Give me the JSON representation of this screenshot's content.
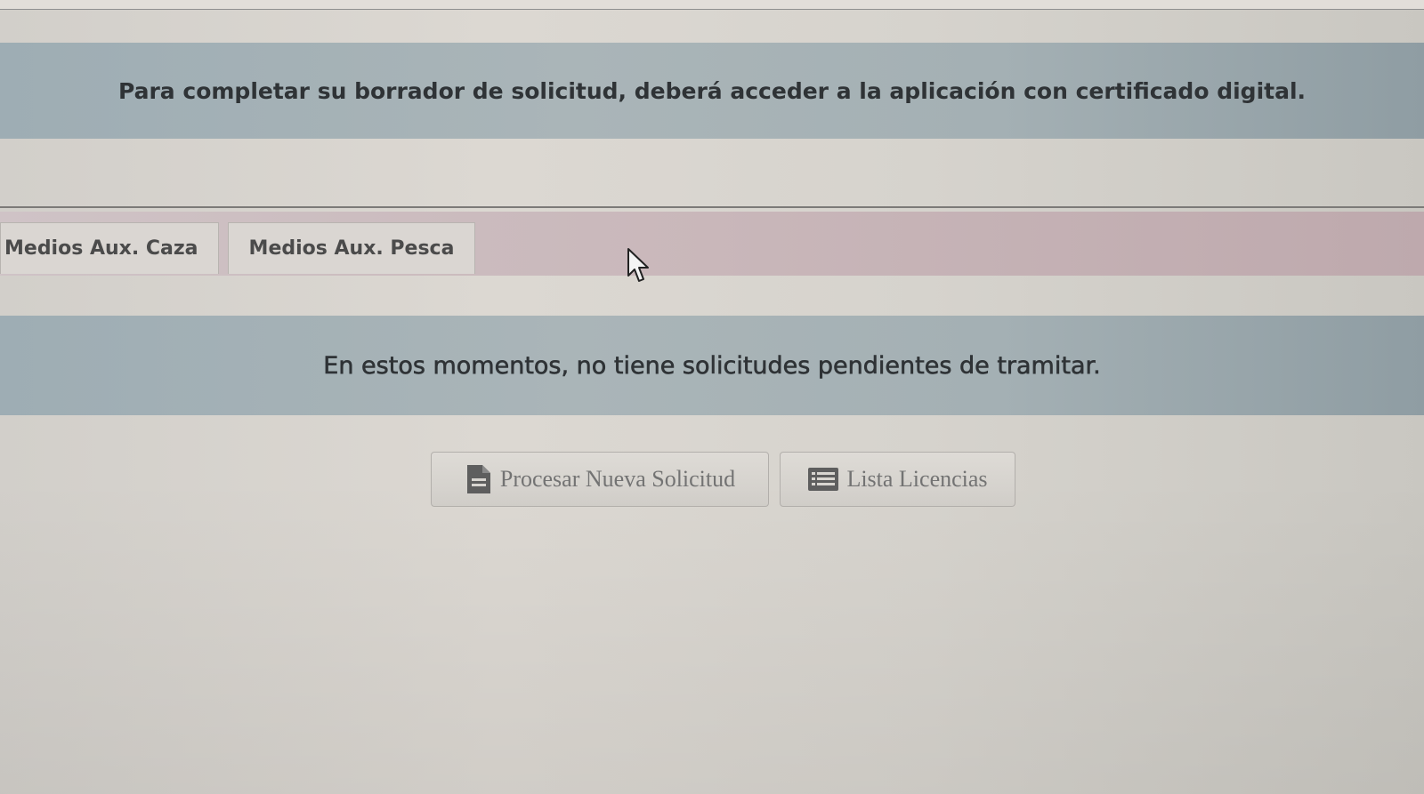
{
  "notice": {
    "message": "Para completar su borrador de solicitud, deberá acceder a la aplicación con certificado digital."
  },
  "tabs": [
    {
      "label": "Medios Aux. Caza"
    },
    {
      "label": "Medios Aux. Pesca"
    }
  ],
  "status": {
    "message": "En estos momentos, no tiene solicitudes pendientes de tramitar."
  },
  "actions": {
    "new_request_label": "Procesar Nueva Solicitud",
    "new_request_icon": "document-icon",
    "license_list_label": "Lista Licencias",
    "license_list_icon": "list-icon"
  },
  "colors": {
    "banner": "#a4b0b4",
    "tabbar": "#c9b7ba",
    "text": "#2f3336"
  }
}
